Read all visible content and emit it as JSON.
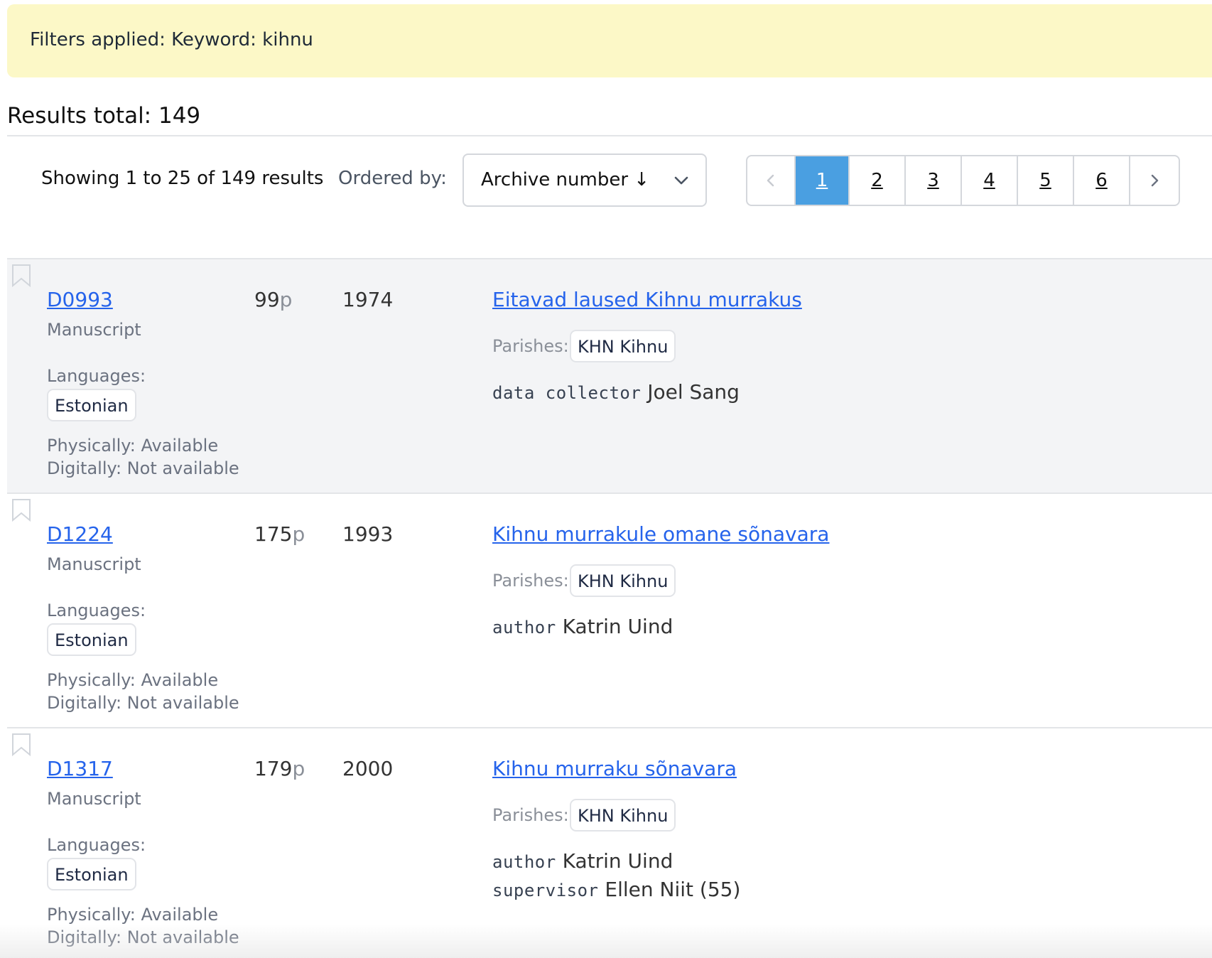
{
  "filters": {
    "text": "Filters applied: Keyword: kihnu"
  },
  "results_total": "Results total: 149",
  "toolbar": {
    "showing": "Showing 1 to 25 of 149 results",
    "ordered_by_label": "Ordered by:",
    "ordered_by_value": "Archive number ↓",
    "ordered_by_icon": "chevron-down-icon"
  },
  "pagination": {
    "prev": "‹",
    "next": "›",
    "pages": [
      "1",
      "2",
      "3",
      "4",
      "5",
      "6"
    ],
    "current": "1",
    "accent": "#4a9fe1"
  },
  "results": [
    {
      "archive_no": "D0993",
      "type": "Manuscript",
      "languages_label": "Languages:",
      "language": "Estonian",
      "physically": "Physically: Available",
      "digitally": "Digitally: Not available",
      "pages": "99",
      "pages_unit": "p",
      "year": "1974",
      "title": "Eitavad laused Kihnu murrakus",
      "parishes_label": "Parishes:",
      "parish": "KHN Kihnu",
      "contributors": [
        {
          "role": "data collector",
          "name": "Joel Sang"
        }
      ]
    },
    {
      "archive_no": "D1224",
      "type": "Manuscript",
      "languages_label": "Languages:",
      "language": "Estonian",
      "physically": "Physically: Available",
      "digitally": "Digitally: Not available",
      "pages": "175",
      "pages_unit": "p",
      "year": "1993",
      "title": "Kihnu murrakule omane sõnavara",
      "parishes_label": "Parishes:",
      "parish": "KHN Kihnu",
      "contributors": [
        {
          "role": "author",
          "name": "Katrin Uind"
        }
      ]
    },
    {
      "archive_no": "D1317",
      "type": "Manuscript",
      "languages_label": "Languages:",
      "language": "Estonian",
      "physically": "Physically: Available",
      "digitally": "Digitally: Not available",
      "pages": "179",
      "pages_unit": "p",
      "year": "2000",
      "title": "Kihnu murraku sõnavara",
      "parishes_label": "Parishes:",
      "parish": "KHN Kihnu",
      "contributors": [
        {
          "role": "author",
          "name": "Katrin Uind"
        },
        {
          "role": "supervisor",
          "name": "Ellen Niit (55)"
        }
      ]
    }
  ],
  "colors": {
    "banner_bg": "#fcf8c7",
    "link": "#2563eb",
    "row_shade": "#f3f4f6"
  },
  "icons": {
    "bookmark": "bookmark-icon"
  }
}
